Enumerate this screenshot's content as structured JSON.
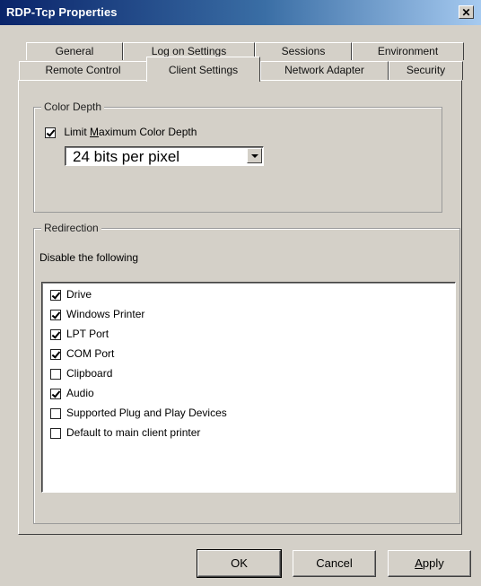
{
  "window": {
    "title": "RDP-Tcp Properties",
    "close_glyph": "✕"
  },
  "tabs_back": [
    "General",
    "Log on Settings",
    "Sessions",
    "Environment"
  ],
  "tabs_front": [
    "Remote Control",
    "Client Settings",
    "Network Adapter",
    "Security"
  ],
  "active_tab": "Client Settings",
  "color_depth": {
    "legend": "Color Depth",
    "limit_label_pre": "Limit ",
    "limit_label_ul": "M",
    "limit_label_post": "aximum Color Depth",
    "limit_checked": true,
    "selected": "24 bits per pixel"
  },
  "redirection": {
    "legend": "Redirection",
    "disable_label": "Disable the following",
    "items": [
      {
        "label": "Drive",
        "checked": true
      },
      {
        "label": "Windows Printer",
        "checked": true
      },
      {
        "label": "LPT Port",
        "checked": true
      },
      {
        "label": "COM Port",
        "checked": true
      },
      {
        "label": "Clipboard",
        "checked": false
      },
      {
        "label": "Audio",
        "checked": true
      },
      {
        "label": "Supported Plug and Play Devices",
        "checked": false
      },
      {
        "label": "Default to main client printer",
        "checked": false
      }
    ]
  },
  "buttons": {
    "ok": "OK",
    "cancel": "Cancel",
    "apply_ul": "A",
    "apply_rest": "pply"
  }
}
